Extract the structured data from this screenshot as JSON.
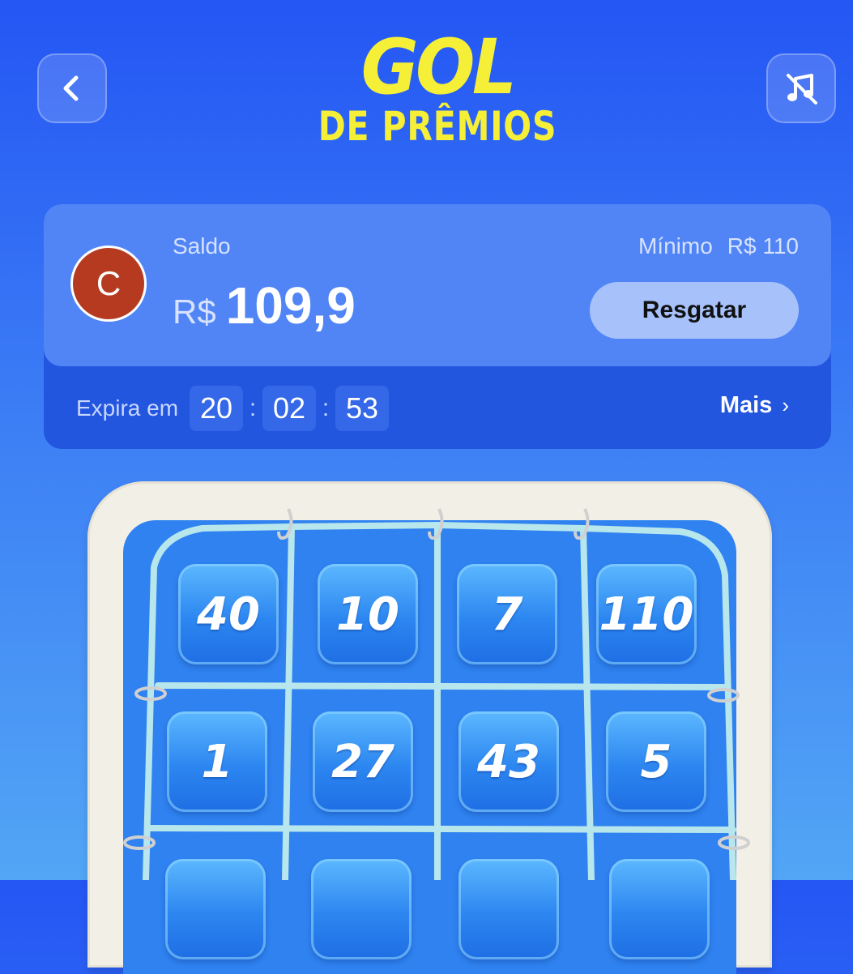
{
  "header": {
    "title_line1": "GOL",
    "title_line2": "DE PRÊMIOS",
    "back_icon": "chevron-left-icon",
    "music_icon": "music-off-icon"
  },
  "balance_card": {
    "avatar_letter": "C",
    "saldo_label": "Saldo",
    "currency": "R$",
    "amount": "109,9",
    "minimum_label": "Mínimo",
    "minimum_value": "R$ 110",
    "redeem_button": "Resgatar",
    "expires_label": "Expira em",
    "timer": {
      "hours": "20",
      "minutes": "02",
      "seconds": "53"
    },
    "more_label": "Mais",
    "more_icon": "chevron-right-icon"
  },
  "grid": {
    "tiles": [
      "40",
      "10",
      "7",
      "110",
      "1",
      "27",
      "43",
      "5"
    ]
  },
  "colors": {
    "title_yellow": "#f5f037",
    "card_top": "#5185f6",
    "card_bottom": "#2356df",
    "avatar": "#b63a20",
    "redeem_button": "#a7c2fb"
  }
}
